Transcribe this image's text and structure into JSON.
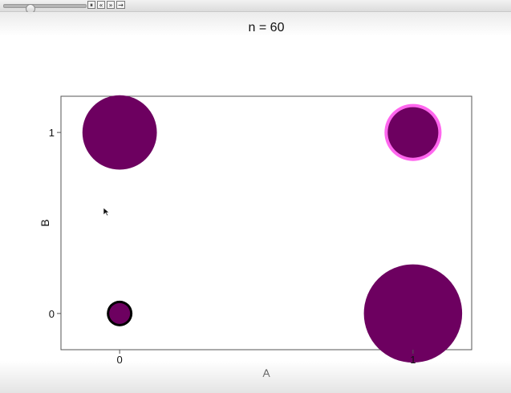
{
  "toolbar": {
    "slider_value": 0.3,
    "pause_label": "⏸",
    "faster_label": "«",
    "slower_label": "»",
    "direction_label": "→"
  },
  "chart_data": {
    "type": "scatter",
    "title": "n = 60",
    "xlabel": "A",
    "ylabel": "B",
    "xlim": [
      -0.2,
      1.2
    ],
    "ylim": [
      -0.2,
      1.2
    ],
    "xticks": [
      0,
      1
    ],
    "xtick_labels": [
      "0",
      "1"
    ],
    "yticks": [
      0,
      1
    ],
    "ytick_labels": [
      "0",
      "1"
    ],
    "grid": false,
    "points": [
      {
        "x": 0,
        "y": 1,
        "size": 0.125,
        "fill": "#6d0060",
        "outline": "none"
      },
      {
        "x": 1,
        "y": 1,
        "size": 0.085,
        "fill": "#6d0060",
        "outline": "#ff66ee"
      },
      {
        "x": 0,
        "y": 0,
        "size": 0.035,
        "fill": "#6d0060",
        "outline": "#000000"
      },
      {
        "x": 1,
        "y": 0,
        "size": 0.165,
        "fill": "#6d0060",
        "outline": "none"
      }
    ]
  }
}
